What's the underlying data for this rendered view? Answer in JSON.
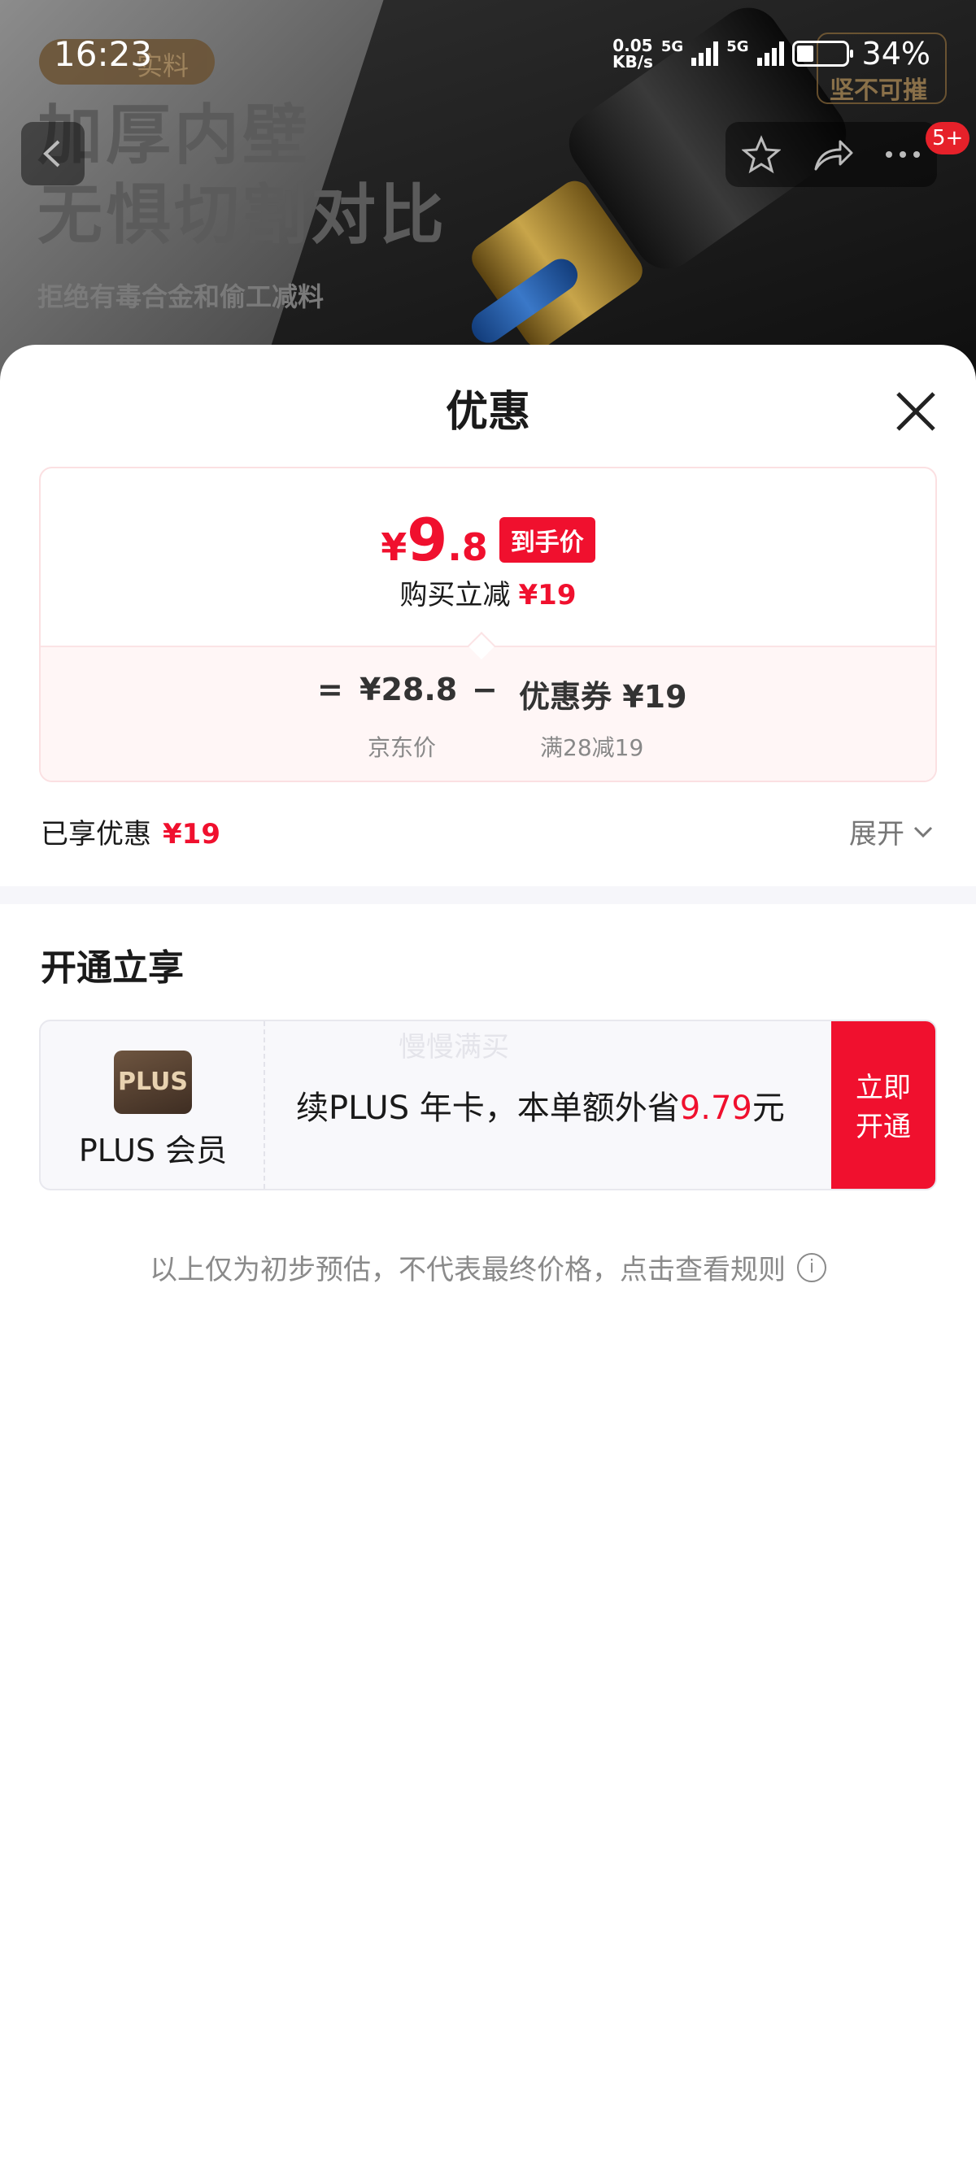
{
  "status_bar": {
    "time": "16:23",
    "net_speed_value": "0.05",
    "net_speed_unit": "KB/s",
    "sim1": "5G",
    "sim2": "5G",
    "battery": "34%"
  },
  "banner": {
    "pill_text": "实料",
    "headline": "加厚内壁\n无惧切割对比",
    "subtitle": "拒绝有毒合金和偷工减料",
    "corner_tag": "坚不可摧",
    "badge": "5+"
  },
  "sheet": {
    "title": "优惠",
    "final_price": {
      "currency": "¥",
      "integer": "9",
      "decimal": ".8",
      "tag": "到手价"
    },
    "instant_discount": {
      "label": "购买立减",
      "value": "¥19"
    },
    "breakdown": {
      "equals": "=",
      "jd_price": "¥28.8",
      "jd_label": "京东价",
      "minus": "−",
      "coupon": "优惠券 ¥19",
      "coupon_rule": "满28减19"
    },
    "enjoyed": {
      "label": "已享优惠",
      "value": "¥19"
    },
    "expand_label": "展开",
    "open_section_title": "开通立享",
    "plus": {
      "logo_text": "PLUS",
      "label": "PLUS 会员",
      "watermark": "慢慢满买",
      "offer_prefix": "续PLUS 年卡，本单额外省",
      "offer_amount": "9.79",
      "offer_suffix": "元",
      "button_line1": "立即",
      "button_line2": "开通"
    },
    "disclaimer": "以上仅为初步预估，不代表最终价格，点击查看规则"
  },
  "colors": {
    "accent_red": "#f0102e",
    "plus_brown": "#5a4330"
  }
}
